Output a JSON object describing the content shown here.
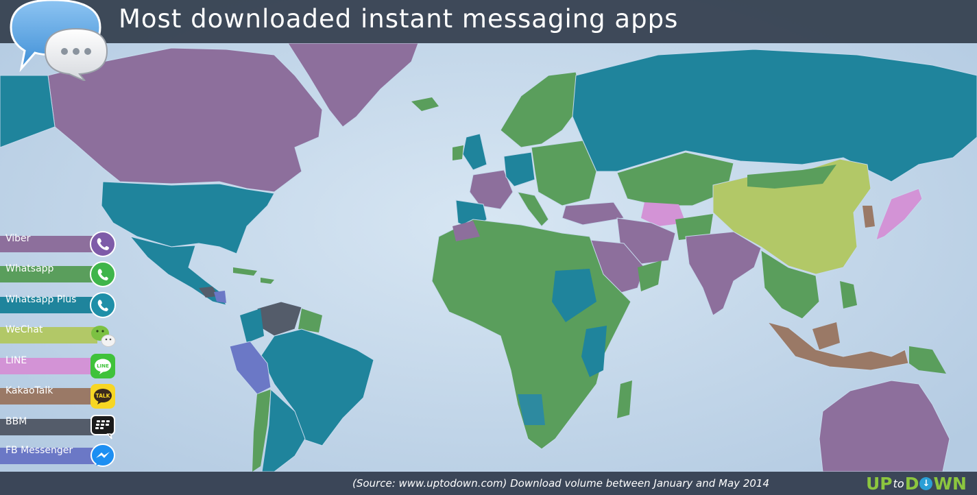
{
  "header": {
    "title": "Most downloaded instant messaging apps"
  },
  "legend": [
    {
      "label": "Viber",
      "color": "#8d6f9c",
      "icon": "viber-icon"
    },
    {
      "label": "Whatsapp",
      "color": "#5a9e5c",
      "icon": "whatsapp-icon"
    },
    {
      "label": "Whatsapp Plus",
      "color": "#1f849c",
      "icon": "whatsapp-plus-icon"
    },
    {
      "label": "WeChat",
      "color": "#b2c867",
      "icon": "wechat-icon"
    },
    {
      "label": "LINE",
      "color": "#d393d6",
      "icon": "line-icon"
    },
    {
      "label": "KakaoTalk",
      "color": "#9a7966",
      "icon": "kakaotalk-icon"
    },
    {
      "label": "BBM",
      "color": "#545c6a",
      "icon": "bbm-icon"
    },
    {
      "label": "FB Messenger",
      "color": "#6b78c6",
      "icon": "fb-messenger-icon"
    }
  ],
  "footer": {
    "source": "(Source: www.uptodown.com) Download volume between January and May 2014"
  },
  "brand": {
    "up": "UP",
    "to": "to",
    "d": "D",
    "wn": "WN"
  },
  "colors": {
    "ocean": "#c5d9ec",
    "header_bg": "#343e4e",
    "footer_bg": "#3b4658",
    "brand_green": "#8cc63f"
  }
}
